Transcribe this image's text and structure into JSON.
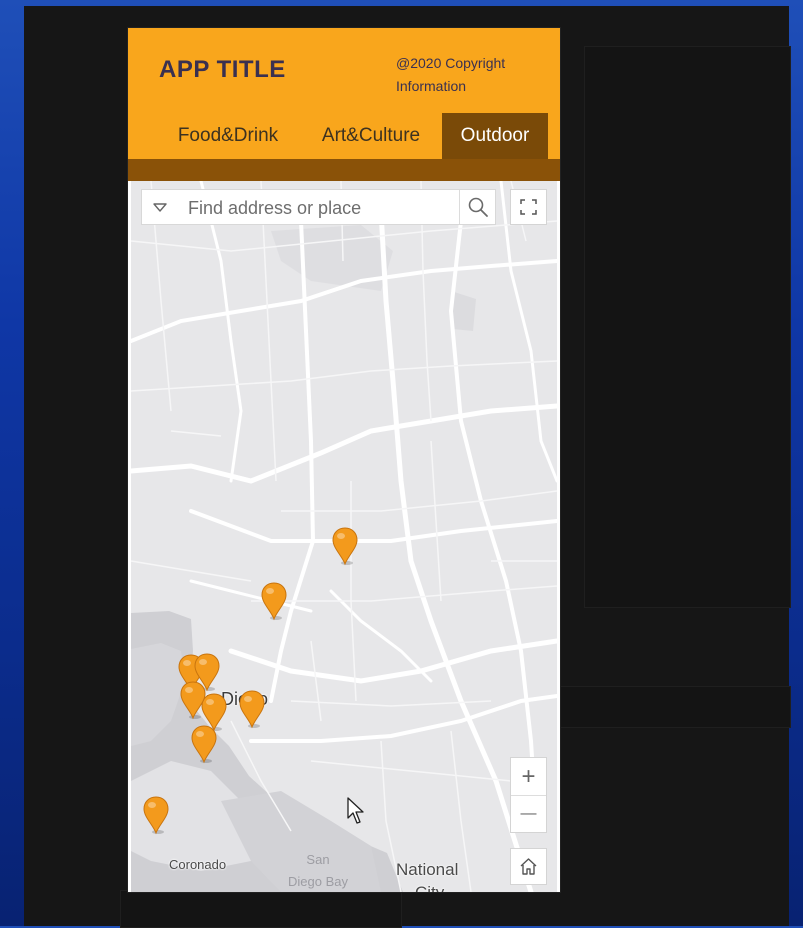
{
  "app": {
    "title": "APP TITLE",
    "copyright": "@2020 Copyright Information"
  },
  "tabs": [
    {
      "label": "Food&Drink",
      "active": false
    },
    {
      "label": "Art&Culture",
      "active": false
    },
    {
      "label": "Outdoor",
      "active": true
    }
  ],
  "search": {
    "placeholder": "Find address or place"
  },
  "map": {
    "labels": {
      "city": "San Diego",
      "coronado": "Coronado",
      "bay_line1": "San",
      "bay_line2": "Diego Bay",
      "national_line1": "National",
      "national_line2": "City"
    },
    "controls": {
      "zoom_in": "+",
      "zoom_out": "—"
    },
    "marker_count": 9
  },
  "colors": {
    "header": "#f9a61c",
    "active_tab": "#7a4a08",
    "marker": "#f39a1c"
  },
  "icons": [
    "dropdown-triangle-icon",
    "search-icon",
    "fullscreen-icon",
    "home-icon",
    "map-marker-icon",
    "mouse-pointer-icon"
  ]
}
